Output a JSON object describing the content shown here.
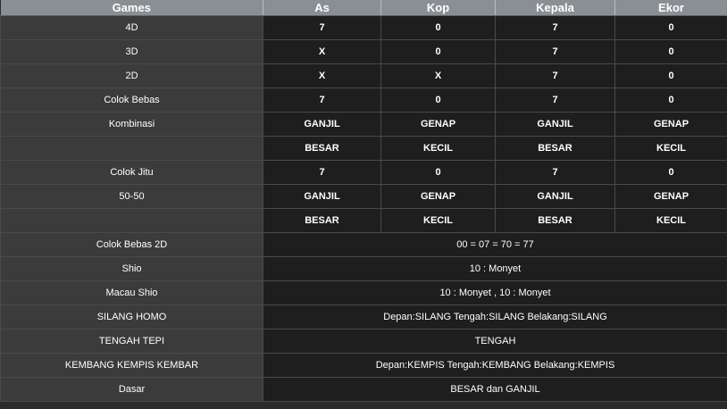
{
  "header": [
    "Games",
    "As",
    "Kop",
    "Kepala",
    "Ekor"
  ],
  "rows4": [
    {
      "label": "4D",
      "values": [
        "7",
        "0",
        "7",
        "0"
      ]
    },
    {
      "label": "3D",
      "values": [
        "X",
        "0",
        "7",
        "0"
      ]
    },
    {
      "label": "2D",
      "values": [
        "X",
        "X",
        "7",
        "0"
      ]
    },
    {
      "label": "Colok Bebas",
      "values": [
        "7",
        "0",
        "7",
        "0"
      ]
    },
    {
      "label": "Kombinasi",
      "values": [
        "GANJIL",
        "GENAP",
        "GANJIL",
        "GENAP"
      ]
    },
    {
      "label": "",
      "values": [
        "BESAR",
        "KECIL",
        "BESAR",
        "KECIL"
      ]
    },
    {
      "label": "Colok Jitu",
      "values": [
        "7",
        "0",
        "7",
        "0"
      ]
    },
    {
      "label": "50-50",
      "values": [
        "GANJIL",
        "GENAP",
        "GANJIL",
        "GENAP"
      ]
    },
    {
      "label": "",
      "values": [
        "BESAR",
        "KECIL",
        "BESAR",
        "KECIL"
      ]
    }
  ],
  "rowsWide": [
    {
      "label": "Colok Bebas 2D",
      "value": "00 = 07 = 70 = 77"
    },
    {
      "label": "Shio",
      "value": "10 : Monyet"
    },
    {
      "label": "Macau Shio",
      "value": "10 : Monyet , 10 : Monyet"
    },
    {
      "label": "SILANG HOMO",
      "value": "Depan:SILANG Tengah:SILANG Belakang:SILANG"
    },
    {
      "label": "TENGAH TEPI",
      "value": "TENGAH"
    },
    {
      "label": "KEMBANG KEMPIS KEMBAR",
      "value": "Depan:KEMPIS Tengah:KEMBANG Belakang:KEMPIS"
    },
    {
      "label": "Dasar",
      "value": "BESAR dan GANJIL"
    }
  ]
}
